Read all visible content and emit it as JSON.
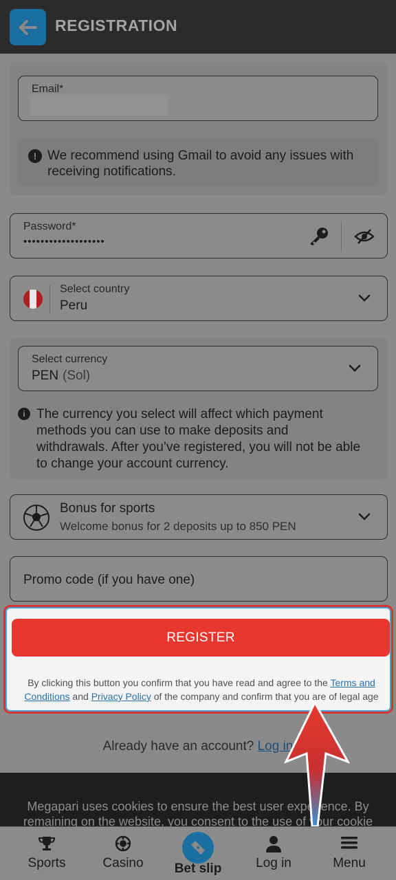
{
  "header": {
    "title": "REGISTRATION"
  },
  "email": {
    "label": "Email*"
  },
  "gmail_note": {
    "text_line1": "We recommend using Gmail to avoid any issues with",
    "text_line2": "receiving notifications."
  },
  "password": {
    "label": "Password*",
    "value": "•••••••••••••••••••"
  },
  "country": {
    "label": "Select country",
    "value": "Peru"
  },
  "currency": {
    "label": "Select currency",
    "code": "PEN",
    "name": "(Sol)"
  },
  "currency_note": {
    "line1": "The currency you select will affect which payment",
    "line2": "methods you can use to make deposits and",
    "line3": "withdrawals. After you’ve registered, you will not be able",
    "line4": "to change your account currency."
  },
  "bonus": {
    "title": "Bonus for sports",
    "subtitle": "Welcome bonus for 2 deposits up to 850 PEN"
  },
  "promo": {
    "placeholder": "Promo code (if you have one)"
  },
  "register": {
    "button": "REGISTER",
    "legal_pre": "By clicking this button you confirm that you have read and agree to the ",
    "terms_link": "Terms and Conditions",
    "legal_mid": " and ",
    "privacy_link": "Privacy Policy",
    "legal_post": " of the company and confirm that you are of legal age"
  },
  "login": {
    "text": "Already have an account? ",
    "link": "Log in"
  },
  "cookie": {
    "text": "Megapari uses cookies to ensure the best user experience. By remaining on the website, you consent to the use of your cookie files"
  },
  "nav": {
    "sports": "Sports",
    "casino": "Casino",
    "betslip": "Bet slip",
    "login": "Log in",
    "menu": "Menu"
  },
  "colors": {
    "accent": "#1b6fa0",
    "register": "#e8372f",
    "header": "#2b2b2b"
  },
  "icons": [
    "back-arrow-icon",
    "info-icon",
    "key-icon",
    "eye-slash-icon",
    "peru-flag-icon",
    "chevron-down-icon",
    "soccer-ball-icon",
    "trophy-icon",
    "casino-chip-icon",
    "ticket-icon",
    "user-icon",
    "menu-icon"
  ]
}
